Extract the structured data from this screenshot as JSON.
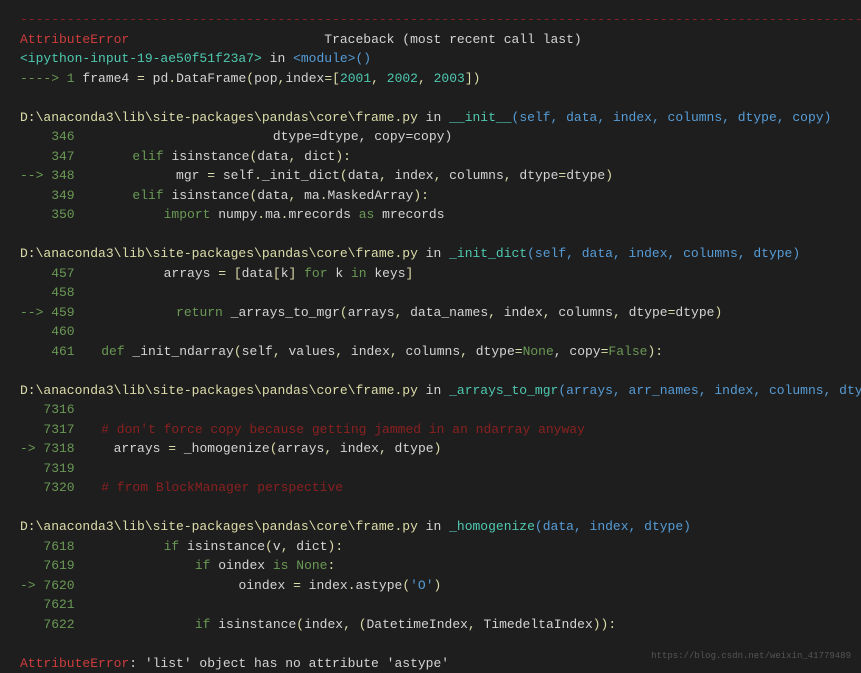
{
  "top_dashes": "------------------------------------------------------------------------------------------------------------",
  "error_name": "AttributeError",
  "traceback_label": "Traceback (most recent call last)",
  "ipython_input": "<ipython-input-19-ae50f51f23a7>",
  "in_word": " in ",
  "module_tag": "<module>",
  "parens": "()",
  "arrow1": "----> 1 ",
  "line1_a": "frame4 ",
  "line1_eq": "= ",
  "line1_b": "pd",
  "line1_dot": ".",
  "line1_c": "DataFrame",
  "line1_d": "(",
  "line1_e": "pop",
  "line1_f": ",",
  "line1_g": "index",
  "line1_h": "=[",
  "line1_i": "2001",
  "line1_j": ", ",
  "line1_k": "2002",
  "line1_l": ", ",
  "line1_m": "2003",
  "line1_n": "])",
  "frame1_path": "D:\\anaconda3\\lib\\site-packages\\pandas\\core\\frame.py",
  "frame1_func": "__init__",
  "frame1_args": "(self, data, index, columns, dtype, copy)",
  "f1_346": "    346 ",
  "f1_346_code": "                          dtype=dtype, copy=copy)",
  "f1_347": "    347 ",
  "f1_347_a": "        ",
  "f1_347_elif": "elif",
  "f1_347_b": " isinstance",
  "f1_347_c": "(",
  "f1_347_d": "data",
  "f1_347_e": ", ",
  "f1_347_f": "dict",
  "f1_347_g": "):",
  "f1_348_arrow": "--> 348 ",
  "f1_348_a": "            mgr ",
  "f1_348_eq": "= ",
  "f1_348_b": "self",
  "f1_348_dot": ".",
  "f1_348_c": "_init_dict",
  "f1_348_d": "(",
  "f1_348_e": "data",
  "f1_348_f": ", ",
  "f1_348_g": "index",
  "f1_348_h": ", ",
  "f1_348_i": "columns",
  "f1_348_j": ", ",
  "f1_348_k": "dtype",
  "f1_348_l": "=",
  "f1_348_m": "dtype",
  "f1_348_n": ")",
  "f1_349": "    349 ",
  "f1_349_a": "        ",
  "f1_349_elif": "elif",
  "f1_349_b": " isinstance",
  "f1_349_c": "(",
  "f1_349_d": "data",
  "f1_349_e": ", ",
  "f1_349_f": "ma",
  "f1_349_g": ".",
  "f1_349_h": "MaskedArray",
  "f1_349_i": "):",
  "f1_350": "    350 ",
  "f1_350_a": "            ",
  "f1_350_import": "import",
  "f1_350_b": " numpy",
  "f1_350_c": ".",
  "f1_350_d": "ma",
  "f1_350_e": ".",
  "f1_350_f": "mrecords ",
  "f1_350_as": "as",
  "f1_350_g": " mrecords",
  "frame2_path": "D:\\anaconda3\\lib\\site-packages\\pandas\\core\\frame.py",
  "frame2_func": "_init_dict",
  "frame2_args": "(self, data, index, columns, dtype)",
  "f2_457": "    457 ",
  "f2_457_a": "            arrays ",
  "f2_457_eq": "= ",
  "f2_457_b": "[",
  "f2_457_c": "data",
  "f2_457_d": "[",
  "f2_457_e": "k",
  "f2_457_f": "] ",
  "f2_457_for": "for",
  "f2_457_g": " k ",
  "f2_457_in": "in",
  "f2_457_h": " keys",
  "f2_457_i": "]",
  "f2_458": "    458 ",
  "f2_459_arrow": "--> 459 ",
  "f2_459_a": "            ",
  "f2_459_return": "return",
  "f2_459_b": " _arrays_to_mgr",
  "f2_459_c": "(",
  "f2_459_d": "arrays",
  "f2_459_e": ", ",
  "f2_459_f": "data_names",
  "f2_459_g": ", ",
  "f2_459_h": "index",
  "f2_459_i": ", ",
  "f2_459_j": "columns",
  "f2_459_k": ", ",
  "f2_459_l": "dtype",
  "f2_459_m": "=",
  "f2_459_n": "dtype",
  "f2_459_o": ")",
  "f2_460": "    460 ",
  "f2_461": "    461 ",
  "f2_461_a": "    ",
  "f2_461_def": "def",
  "f2_461_b": " _init_ndarray",
  "f2_461_c": "(",
  "f2_461_d": "self",
  "f2_461_e": ", ",
  "f2_461_f": "values",
  "f2_461_g": ", ",
  "f2_461_h": "index",
  "f2_461_i": ", ",
  "f2_461_j": "columns",
  "f2_461_k": ", ",
  "f2_461_l": "dtype",
  "f2_461_m": "=",
  "f2_461_none": "None",
  "f2_461_n": ", copy",
  "f2_461_o": "=",
  "f2_461_false": "False",
  "f2_461_p": "):",
  "frame3_path": "D:\\anaconda3\\lib\\site-packages\\pandas\\core\\frame.py",
  "frame3_func": "_arrays_to_mgr",
  "frame3_args": "(arrays, arr_names, index, columns, dtype)",
  "f3_7316": "   7316 ",
  "f3_7317": "   7317 ",
  "f3_7317_comment": "    # don't force copy because getting jammed in an ndarray anyway",
  "f3_7318_arrow": "-> 7318 ",
  "f3_7318_a": "    arrays ",
  "f3_7318_eq": "= ",
  "f3_7318_b": "_homogenize",
  "f3_7318_c": "(",
  "f3_7318_d": "arrays",
  "f3_7318_e": ", ",
  "f3_7318_f": "index",
  "f3_7318_g": ", ",
  "f3_7318_h": "dtype",
  "f3_7318_i": ")",
  "f3_7319": "   7319 ",
  "f3_7320": "   7320 ",
  "f3_7320_comment": "    # from BlockManager perspective",
  "frame4_path": "D:\\anaconda3\\lib\\site-packages\\pandas\\core\\frame.py",
  "frame4_func": "_homogenize",
  "frame4_args": "(data, index, dtype)",
  "f4_7618": "   7618 ",
  "f4_7618_a": "            ",
  "f4_7618_if": "if",
  "f4_7618_b": " isinstance",
  "f4_7618_c": "(",
  "f4_7618_d": "v",
  "f4_7618_e": ", ",
  "f4_7618_f": "dict",
  "f4_7618_g": "):",
  "f4_7619": "   7619 ",
  "f4_7619_a": "                ",
  "f4_7619_if": "if",
  "f4_7619_b": " oindex ",
  "f4_7619_is": "is",
  "f4_7619_c": " ",
  "f4_7619_none": "None",
  "f4_7619_d": ":",
  "f4_7620_arrow": "-> 7620 ",
  "f4_7620_a": "                    oindex ",
  "f4_7620_eq": "= ",
  "f4_7620_b": "index",
  "f4_7620_c": ".",
  "f4_7620_d": "astype",
  "f4_7620_e": "(",
  "f4_7620_f": "'O'",
  "f4_7620_g": ")",
  "f4_7621": "   7621 ",
  "f4_7622": "   7622 ",
  "f4_7622_a": "                ",
  "f4_7622_if": "if",
  "f4_7622_b": " isinstance",
  "f4_7622_c": "(",
  "f4_7622_d": "index",
  "f4_7622_e": ", (",
  "f4_7622_f": "DatetimeIndex",
  "f4_7622_g": ", ",
  "f4_7622_h": "TimedeltaIndex",
  "f4_7622_i": ")):",
  "final_error": "AttributeError",
  "final_msg": ": 'list' object has no attribute 'astype'",
  "watermark": "https://blog.csdn.net/weixin_41779489"
}
